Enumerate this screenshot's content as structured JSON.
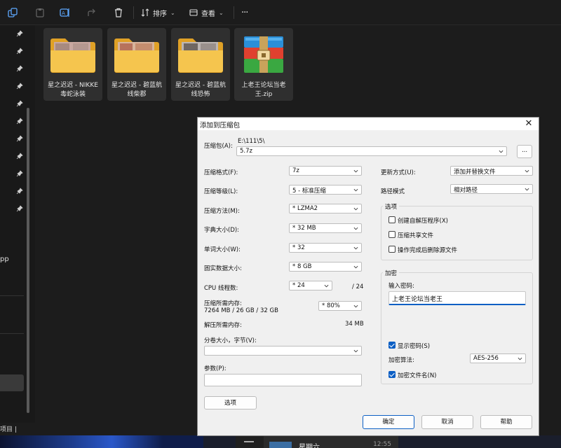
{
  "toolbar": {
    "sort_label": "排序",
    "view_label": "查看",
    "more_label": "···"
  },
  "left": {
    "clipped_text": "pp",
    "status_text": "项目  |"
  },
  "files": [
    {
      "name": "星之迟迟 - NIKKE毒蛇泳装",
      "type": "folder"
    },
    {
      "name": "星之迟迟 - 碧蓝航线柴郡",
      "type": "folder"
    },
    {
      "name": "星之迟迟 - 碧蓝航线恐怖",
      "type": "folder"
    },
    {
      "name": "上老王论坛当老王.zip",
      "type": "winrar-archive"
    }
  ],
  "taskbar": {
    "notif_title": "星期六",
    "notif_time": "12:55"
  },
  "dialog": {
    "title": "添加到压缩包",
    "archive_label": "压缩包(A):",
    "archive_path": "E:\\111\\5\\",
    "archive_name": "5.7z",
    "browse_label": "...",
    "format_label": "压缩格式(F):",
    "format_value": "7z",
    "level_label": "压缩等级(L):",
    "level_value": "5 - 标准压缩",
    "method_label": "压缩方法(M):",
    "method_value": "*  LZMA2",
    "dict_label": "字典大小(D):",
    "dict_value": "*  32 MB",
    "word_label": "单词大小(W):",
    "word_value": "*  32",
    "solid_label": "固实数据大小:",
    "solid_value": "*  8 GB",
    "threads_label": "CPU 线程数:",
    "threads_value": "*  24",
    "threads_total": "/ 24",
    "mem_label": "压缩所需内存:",
    "mem_detail": "7264 MB / 26 GB / 32 GB",
    "mem_value": "*  80%",
    "decomp_label": "解压所需内存:",
    "decomp_value": "34 MB",
    "split_label": "分卷大小，字节(V):",
    "split_value": "",
    "params_label": "参数(P):",
    "params_value": "",
    "options_button": "选项",
    "update_label": "更新方式(U):",
    "update_value": "添加并替换文件",
    "path_label": "路径模式",
    "path_value": "相对路径",
    "options_group": "选项",
    "opt_sfx": "创建自解压程序(X)",
    "opt_shared": "压缩共享文件",
    "opt_delete": "操作完成后删除源文件",
    "encrypt_group": "加密",
    "pwd_label": "输入密码:",
    "pwd_value": "上老王论坛当老王",
    "show_pwd": "显示密码(S)",
    "algo_label": "加密算法:",
    "algo_value": "AES-256",
    "encrypt_names": "加密文件名(N)",
    "ok": "确定",
    "cancel": "取消",
    "help": "帮助",
    "checks": {
      "sfx": false,
      "shared": false,
      "delete": false,
      "show_pwd": true,
      "encrypt_names": true
    }
  }
}
